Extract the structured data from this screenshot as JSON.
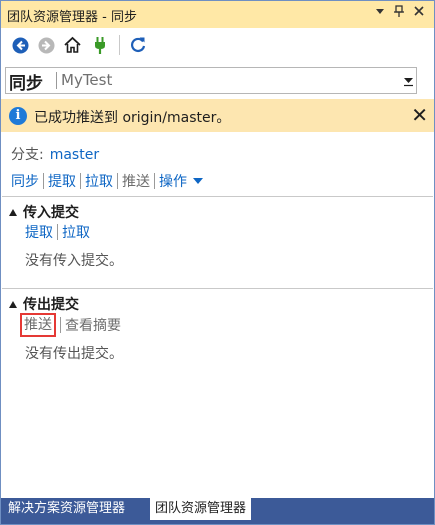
{
  "window": {
    "title": "团队资源管理器 - 同步",
    "controls": {
      "dropdown": "▼",
      "pin": "൯",
      "close": "✕"
    }
  },
  "toolbar": {
    "icons": [
      "back-icon",
      "forward-icon",
      "home-icon",
      "connect-plug-icon",
      "refresh-icon"
    ]
  },
  "page_header": {
    "title": "同步",
    "subtitle": "MyTest"
  },
  "notification": {
    "icon": "i",
    "message": "已成功推送到 origin/master。",
    "close": "✕"
  },
  "branch": {
    "label": "分支:",
    "value": "master"
  },
  "actions": {
    "sync": "同步",
    "fetch": "提取",
    "pull": "拉取",
    "push": "推送",
    "operations": "操作"
  },
  "incoming": {
    "title": "传入提交",
    "fetch": "提取",
    "pull": "拉取",
    "empty": "没有传入提交。"
  },
  "outgoing": {
    "title": "传出提交",
    "push": "推送",
    "view_summary": "查看摘要",
    "empty": "没有传出提交。"
  },
  "tabs": [
    {
      "label": "解决方案资源管理器",
      "active": false
    },
    {
      "label": "团队资源管理器",
      "active": true
    }
  ],
  "colors": {
    "title_bar": "#ffe8a6",
    "notification": "#fde6b0",
    "link": "#0e66c4",
    "tab_bar": "#3c5a98",
    "highlight_box": "#e53935"
  }
}
